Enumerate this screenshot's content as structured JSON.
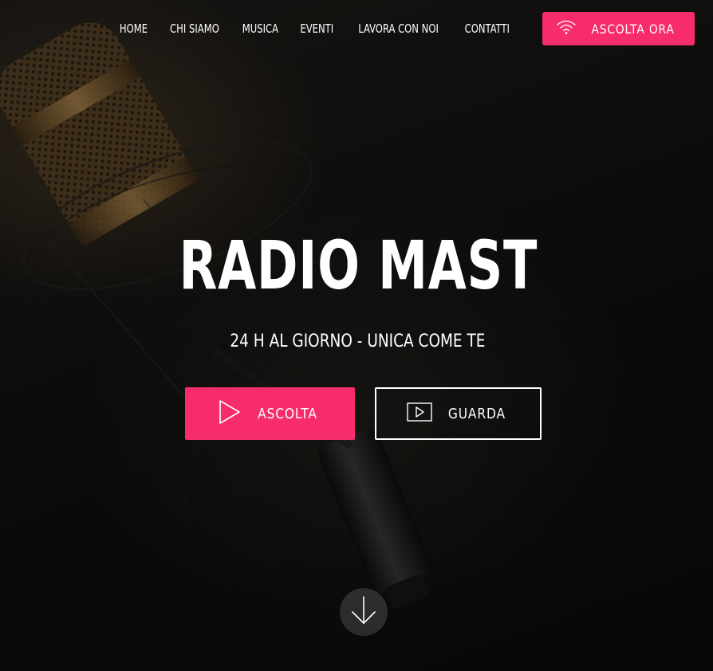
{
  "nav": {
    "items": [
      {
        "label": "HOME"
      },
      {
        "label": "CHI SIAMO"
      },
      {
        "label": "MUSICA"
      },
      {
        "label": "EVENTI"
      },
      {
        "label": "LAVORA CON NOI"
      },
      {
        "label": "CONTATTI"
      }
    ],
    "cta": {
      "label": "ASCOLTA ORA",
      "icon": "wifi-icon"
    }
  },
  "hero": {
    "title": "RADIO MAST",
    "subtitle": "24 H AL GIORNO - UNICA COME TE",
    "buttons": {
      "listen": {
        "label": "ASCOLTA",
        "icon": "play-icon"
      },
      "watch": {
        "label": "GUARDA",
        "icon": "video-play-icon"
      }
    },
    "scroll": {
      "icon": "arrow-down-icon"
    }
  },
  "colors": {
    "accent": "#f72d6b",
    "text": "#ffffff",
    "background": "#121110"
  }
}
